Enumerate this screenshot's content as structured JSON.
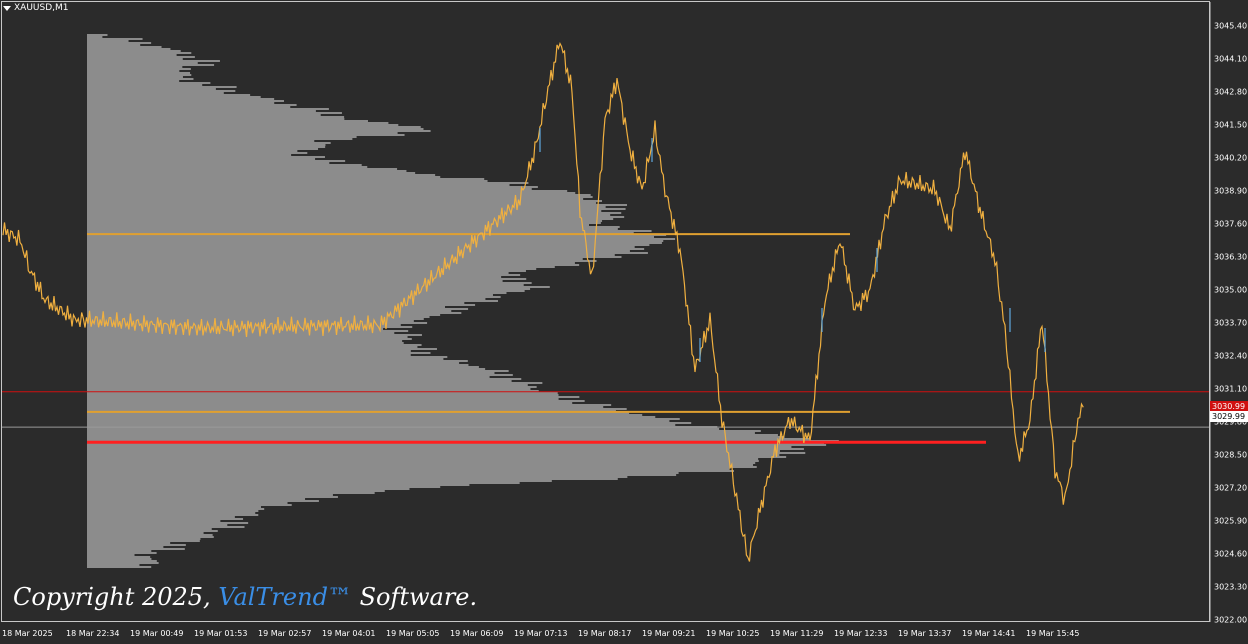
{
  "window": {
    "symbol": "XAUUSD,M1"
  },
  "price_axis": {
    "labels": [
      "3045.40",
      "3044.10",
      "3042.80",
      "3041.50",
      "3040.20",
      "3038.90",
      "3037.60",
      "3036.30",
      "3035.00",
      "3033.70",
      "3032.40",
      "3031.10",
      "3029.80",
      "3028.50",
      "3027.20",
      "3025.90",
      "3024.60",
      "3023.30",
      "3022.00"
    ],
    "values": [
      3045.4,
      3044.1,
      3042.8,
      3041.5,
      3040.2,
      3038.9,
      3037.6,
      3036.3,
      3035.0,
      3033.7,
      3032.4,
      3031.1,
      3029.8,
      3028.5,
      3027.2,
      3025.9,
      3024.6,
      3023.3,
      3022.0
    ],
    "bid_price": "3029.99",
    "red_price_label": "3030.99",
    "red_price_value": 3030.99
  },
  "time_axis": {
    "labels": [
      "18 Mar 2025",
      "18 Mar 22:34",
      "19 Mar 00:49",
      "19 Mar 01:53",
      "19 Mar 02:57",
      "19 Mar 04:01",
      "19 Mar 05:05",
      "19 Mar 06:09",
      "19 Mar 07:13",
      "19 Mar 08:17",
      "19 Mar 09:21",
      "19 Mar 10:25",
      "19 Mar 11:29",
      "19 Mar 12:33",
      "19 Mar 13:37",
      "19 Mar 14:41",
      "19 Mar 15:45"
    ]
  },
  "levels": {
    "value_area_high": 3037.2,
    "value_area_low": 3030.2,
    "point_of_control": 3029.0
  },
  "colors": {
    "background": "#2b2b2b",
    "axis_text": "#ffffff",
    "profile": "#8c8c8c",
    "candle_up": "#f0b040",
    "candle_alt": "#5fa8e0",
    "value_area_line": "#e0a030",
    "poc_line": "#ff2020",
    "bid_line": "#9a9a9a",
    "red_marker": "#d01010"
  },
  "copyright": {
    "prefix": "Copyright 2025, ",
    "brand": "ValTrend™",
    "suffix": "  Software."
  }
}
